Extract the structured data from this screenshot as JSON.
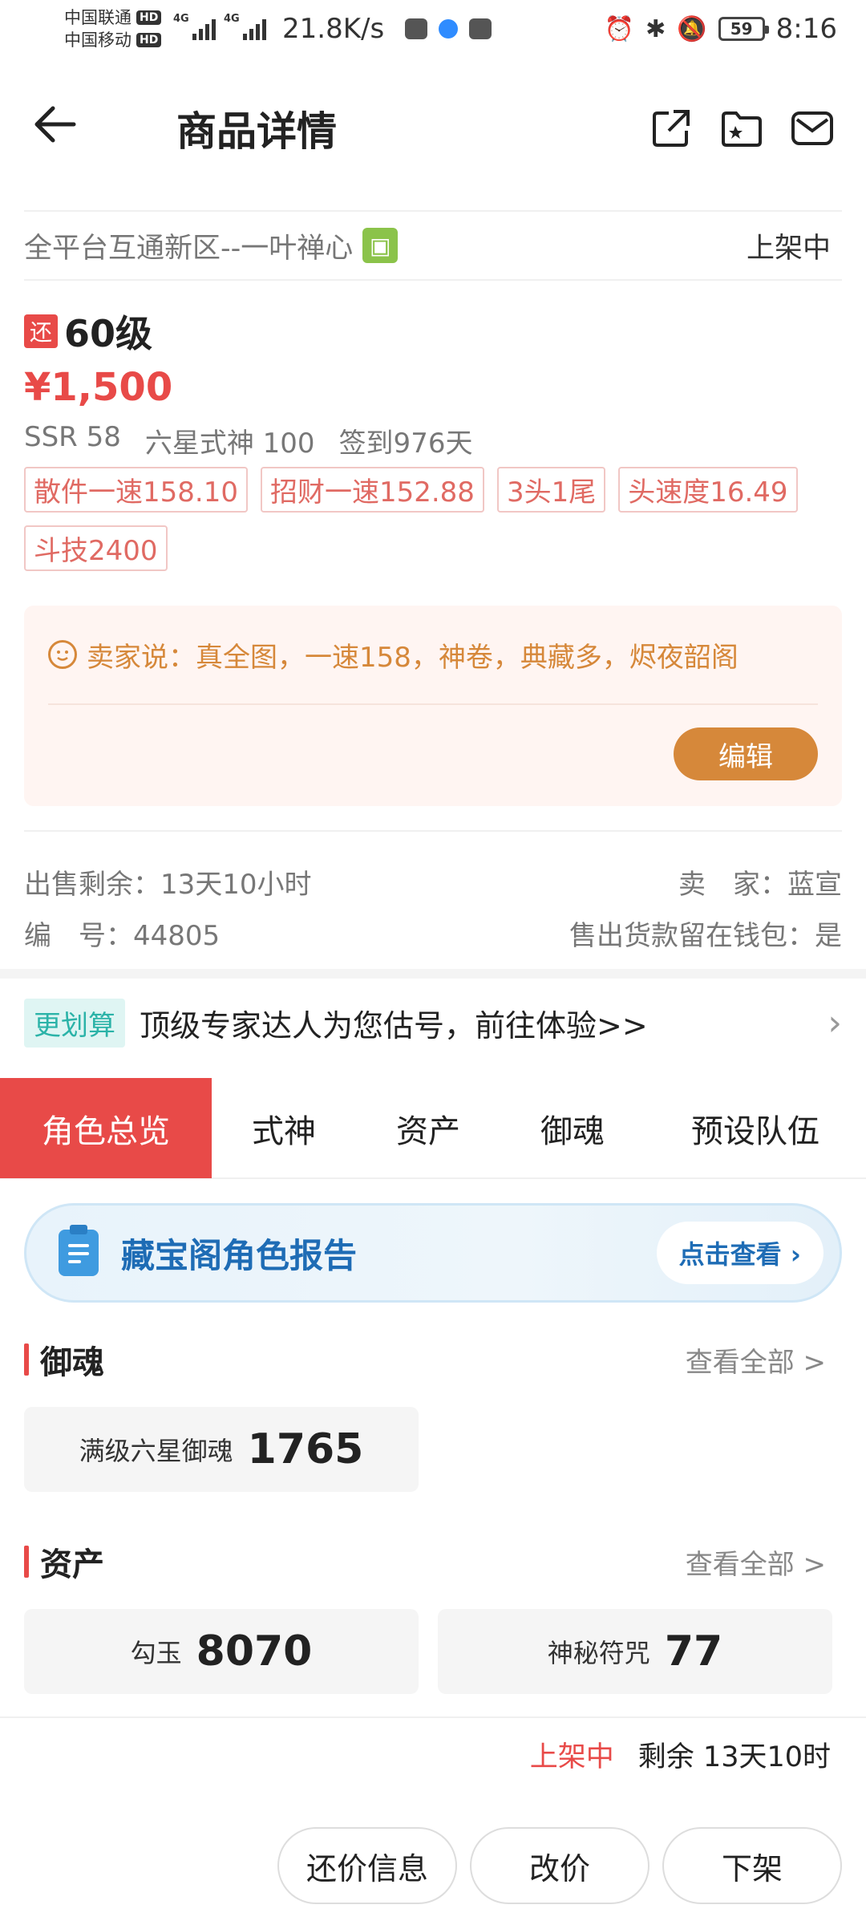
{
  "status_bar": {
    "carrier1": "中国联通",
    "carrier2": "中国移动",
    "hd": "HD",
    "net1": "4G",
    "net2": "4G",
    "speed": "21.8K/s",
    "battery": "59",
    "time": "8:16"
  },
  "header": {
    "title": "商品详情",
    "icons": [
      "share-icon",
      "favorite-folder-icon",
      "message-icon"
    ]
  },
  "item": {
    "server": "全平台互通新区--一叶禅心",
    "status": "上架中",
    "bargain_badge": "还",
    "level": "60级",
    "price": "¥1,500",
    "meta": [
      "SSR 58",
      "六星式神 100",
      "签到976天"
    ],
    "tags": [
      "散件一速158.10",
      "招财一速152.88",
      "3头1尾",
      "头速度16.49",
      "斗技2400"
    ]
  },
  "seller_note": {
    "text": "卖家说：真全图，一速158，神卷，典藏多，烬夜韶阁",
    "edit_label": "编辑"
  },
  "info": {
    "remain_label": "出售剩余：13天10小时",
    "seller_label": "卖　家：蓝宣",
    "id_label": "编　号：44805",
    "wallet_label": "售出货款留在钱包：是"
  },
  "promo": {
    "badge": "更划算",
    "text": "顶级专家达人为您估号，前往体验>>"
  },
  "tabs": [
    "角色总览",
    "式神",
    "资产",
    "御魂",
    "预设队伍"
  ],
  "report": {
    "title": "藏宝阁角色报告",
    "button": "点击查看 ›"
  },
  "yuhun": {
    "title": "御魂",
    "see_all": "查看全部 >",
    "cards": [
      {
        "label": "满级六星御魂",
        "value": "1765"
      }
    ]
  },
  "assets": {
    "title": "资产",
    "see_all": "查看全部 >",
    "cards": [
      {
        "label": "勾玉",
        "value": "8070"
      },
      {
        "label": "神秘符咒",
        "value": "77"
      }
    ]
  },
  "bottom_bar": {
    "status": "上架中",
    "remain": "剩余 13天10时",
    "buttons": [
      "还价信息",
      "改价",
      "下架"
    ]
  },
  "colors": {
    "accent_red": "#e84a48",
    "seller_orange": "#d6883a",
    "report_blue": "#1e6cb5",
    "promo_teal": "#2bb3a8"
  }
}
